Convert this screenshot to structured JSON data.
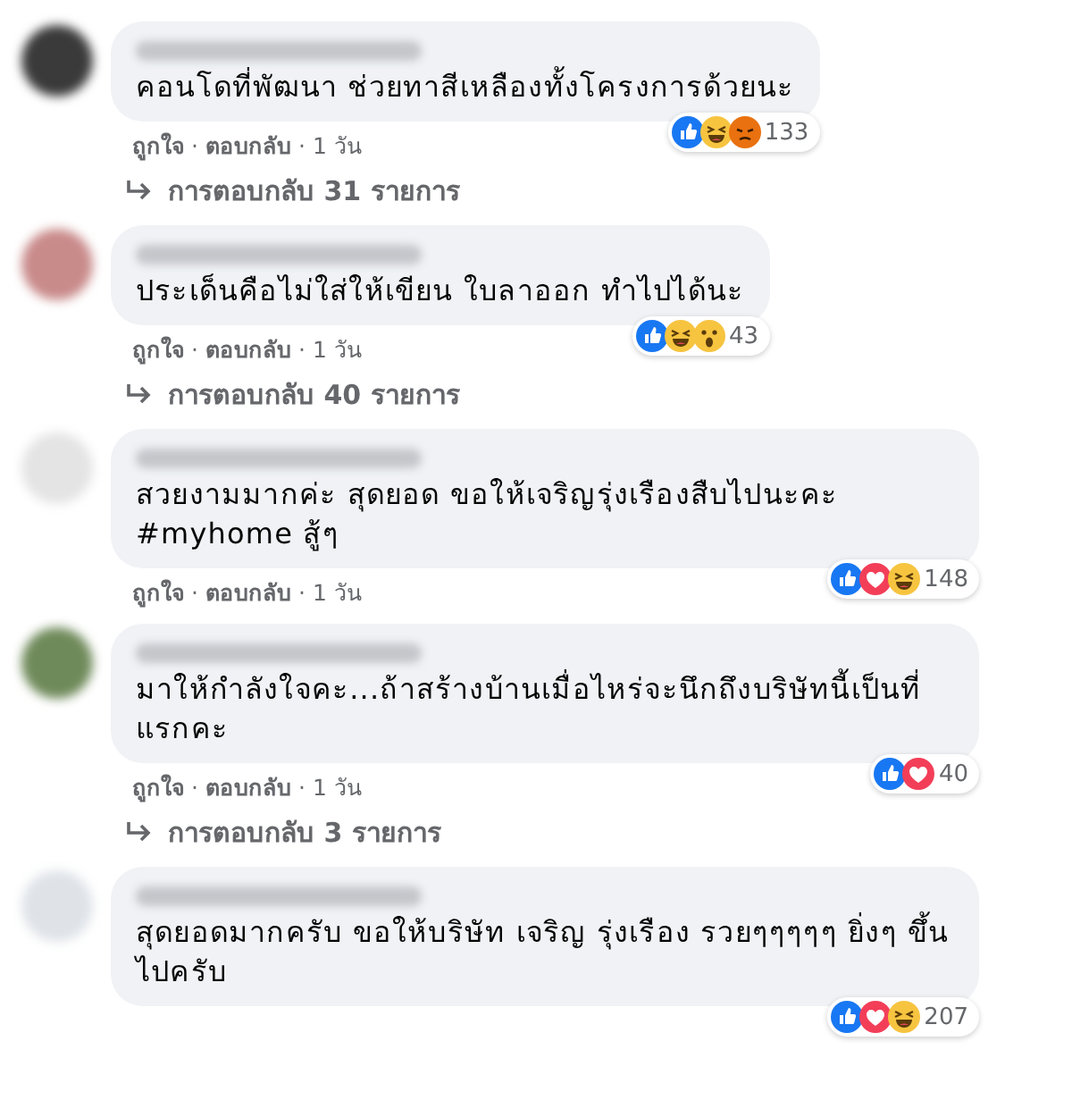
{
  "comments": [
    {
      "text": "คอนโดที่พัฒนา ช่วยทาสีเหลืองทั้งโครงการด้วยนะ",
      "reactions": [
        {
          "kind": "like"
        },
        {
          "kind": "haha"
        },
        {
          "kind": "angry"
        }
      ],
      "reaction_count": "133",
      "actions": [
        "ถูกใจ",
        "ตอบกลับ",
        "1 วัน"
      ],
      "separator": "·",
      "replies": "การตอบกลับ 31 รายการ"
    },
    {
      "text": "ประเด็นคือไม่ใส่ให้เขียน ใบลาออก ทำไปได้นะ",
      "reactions": [
        {
          "kind": "like"
        },
        {
          "kind": "haha"
        },
        {
          "kind": "wow"
        }
      ],
      "reaction_count": "43",
      "actions": [
        "ถูกใจ",
        "ตอบกลับ",
        "1 วัน"
      ],
      "separator": "·",
      "replies": "การตอบกลับ 40 รายการ"
    },
    {
      "text": "สวยงามมากค่ะ สุดยอด ขอให้เจริญรุ่งเรืองสืบไปนะคะ #myhome สู้ๆ",
      "reactions": [
        {
          "kind": "like"
        },
        {
          "kind": "love"
        },
        {
          "kind": "haha"
        }
      ],
      "reaction_count": "148",
      "actions": [
        "ถูกใจ",
        "ตอบกลับ",
        "1 วัน"
      ],
      "separator": "·"
    },
    {
      "text": "มาให้กำลังใจคะ...ถ้าสร้างบ้านเมื่อไหร่จะนึกถึงบริษัทนี้เป็นที่แรกคะ",
      "reactions": [
        {
          "kind": "like"
        },
        {
          "kind": "love"
        }
      ],
      "reaction_count": "40",
      "actions": [
        "ถูกใจ",
        "ตอบกลับ",
        "1 วัน"
      ],
      "separator": "·",
      "replies": "การตอบกลับ 3 รายการ"
    },
    {
      "text": "สุดยอดมากครับ ขอให้บริษัท เจริญ รุ่งเรือง รวยๆๆๆๆๆ ยิ่งๆ ขึ้นไปครับ",
      "reactions": [
        {
          "kind": "like"
        },
        {
          "kind": "love"
        },
        {
          "kind": "haha"
        }
      ],
      "reaction_count": "207"
    }
  ]
}
